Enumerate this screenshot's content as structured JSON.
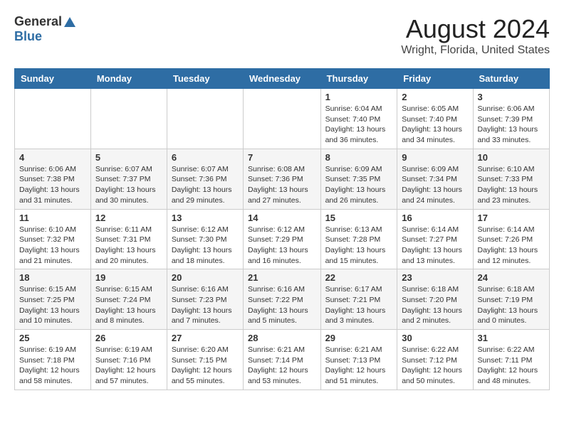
{
  "header": {
    "logo_general": "General",
    "logo_blue": "Blue",
    "title": "August 2024",
    "subtitle": "Wright, Florida, United States"
  },
  "weekdays": [
    "Sunday",
    "Monday",
    "Tuesday",
    "Wednesday",
    "Thursday",
    "Friday",
    "Saturday"
  ],
  "weeks": [
    [
      {
        "day": "",
        "info": ""
      },
      {
        "day": "",
        "info": ""
      },
      {
        "day": "",
        "info": ""
      },
      {
        "day": "",
        "info": ""
      },
      {
        "day": "1",
        "info": "Sunrise: 6:04 AM\nSunset: 7:40 PM\nDaylight: 13 hours\nand 36 minutes."
      },
      {
        "day": "2",
        "info": "Sunrise: 6:05 AM\nSunset: 7:40 PM\nDaylight: 13 hours\nand 34 minutes."
      },
      {
        "day": "3",
        "info": "Sunrise: 6:06 AM\nSunset: 7:39 PM\nDaylight: 13 hours\nand 33 minutes."
      }
    ],
    [
      {
        "day": "4",
        "info": "Sunrise: 6:06 AM\nSunset: 7:38 PM\nDaylight: 13 hours\nand 31 minutes."
      },
      {
        "day": "5",
        "info": "Sunrise: 6:07 AM\nSunset: 7:37 PM\nDaylight: 13 hours\nand 30 minutes."
      },
      {
        "day": "6",
        "info": "Sunrise: 6:07 AM\nSunset: 7:36 PM\nDaylight: 13 hours\nand 29 minutes."
      },
      {
        "day": "7",
        "info": "Sunrise: 6:08 AM\nSunset: 7:36 PM\nDaylight: 13 hours\nand 27 minutes."
      },
      {
        "day": "8",
        "info": "Sunrise: 6:09 AM\nSunset: 7:35 PM\nDaylight: 13 hours\nand 26 minutes."
      },
      {
        "day": "9",
        "info": "Sunrise: 6:09 AM\nSunset: 7:34 PM\nDaylight: 13 hours\nand 24 minutes."
      },
      {
        "day": "10",
        "info": "Sunrise: 6:10 AM\nSunset: 7:33 PM\nDaylight: 13 hours\nand 23 minutes."
      }
    ],
    [
      {
        "day": "11",
        "info": "Sunrise: 6:10 AM\nSunset: 7:32 PM\nDaylight: 13 hours\nand 21 minutes."
      },
      {
        "day": "12",
        "info": "Sunrise: 6:11 AM\nSunset: 7:31 PM\nDaylight: 13 hours\nand 20 minutes."
      },
      {
        "day": "13",
        "info": "Sunrise: 6:12 AM\nSunset: 7:30 PM\nDaylight: 13 hours\nand 18 minutes."
      },
      {
        "day": "14",
        "info": "Sunrise: 6:12 AM\nSunset: 7:29 PM\nDaylight: 13 hours\nand 16 minutes."
      },
      {
        "day": "15",
        "info": "Sunrise: 6:13 AM\nSunset: 7:28 PM\nDaylight: 13 hours\nand 15 minutes."
      },
      {
        "day": "16",
        "info": "Sunrise: 6:14 AM\nSunset: 7:27 PM\nDaylight: 13 hours\nand 13 minutes."
      },
      {
        "day": "17",
        "info": "Sunrise: 6:14 AM\nSunset: 7:26 PM\nDaylight: 13 hours\nand 12 minutes."
      }
    ],
    [
      {
        "day": "18",
        "info": "Sunrise: 6:15 AM\nSunset: 7:25 PM\nDaylight: 13 hours\nand 10 minutes."
      },
      {
        "day": "19",
        "info": "Sunrise: 6:15 AM\nSunset: 7:24 PM\nDaylight: 13 hours\nand 8 minutes."
      },
      {
        "day": "20",
        "info": "Sunrise: 6:16 AM\nSunset: 7:23 PM\nDaylight: 13 hours\nand 7 minutes."
      },
      {
        "day": "21",
        "info": "Sunrise: 6:16 AM\nSunset: 7:22 PM\nDaylight: 13 hours\nand 5 minutes."
      },
      {
        "day": "22",
        "info": "Sunrise: 6:17 AM\nSunset: 7:21 PM\nDaylight: 13 hours\nand 3 minutes."
      },
      {
        "day": "23",
        "info": "Sunrise: 6:18 AM\nSunset: 7:20 PM\nDaylight: 13 hours\nand 2 minutes."
      },
      {
        "day": "24",
        "info": "Sunrise: 6:18 AM\nSunset: 7:19 PM\nDaylight: 13 hours\nand 0 minutes."
      }
    ],
    [
      {
        "day": "25",
        "info": "Sunrise: 6:19 AM\nSunset: 7:18 PM\nDaylight: 12 hours\nand 58 minutes."
      },
      {
        "day": "26",
        "info": "Sunrise: 6:19 AM\nSunset: 7:16 PM\nDaylight: 12 hours\nand 57 minutes."
      },
      {
        "day": "27",
        "info": "Sunrise: 6:20 AM\nSunset: 7:15 PM\nDaylight: 12 hours\nand 55 minutes."
      },
      {
        "day": "28",
        "info": "Sunrise: 6:21 AM\nSunset: 7:14 PM\nDaylight: 12 hours\nand 53 minutes."
      },
      {
        "day": "29",
        "info": "Sunrise: 6:21 AM\nSunset: 7:13 PM\nDaylight: 12 hours\nand 51 minutes."
      },
      {
        "day": "30",
        "info": "Sunrise: 6:22 AM\nSunset: 7:12 PM\nDaylight: 12 hours\nand 50 minutes."
      },
      {
        "day": "31",
        "info": "Sunrise: 6:22 AM\nSunset: 7:11 PM\nDaylight: 12 hours\nand 48 minutes."
      }
    ]
  ]
}
